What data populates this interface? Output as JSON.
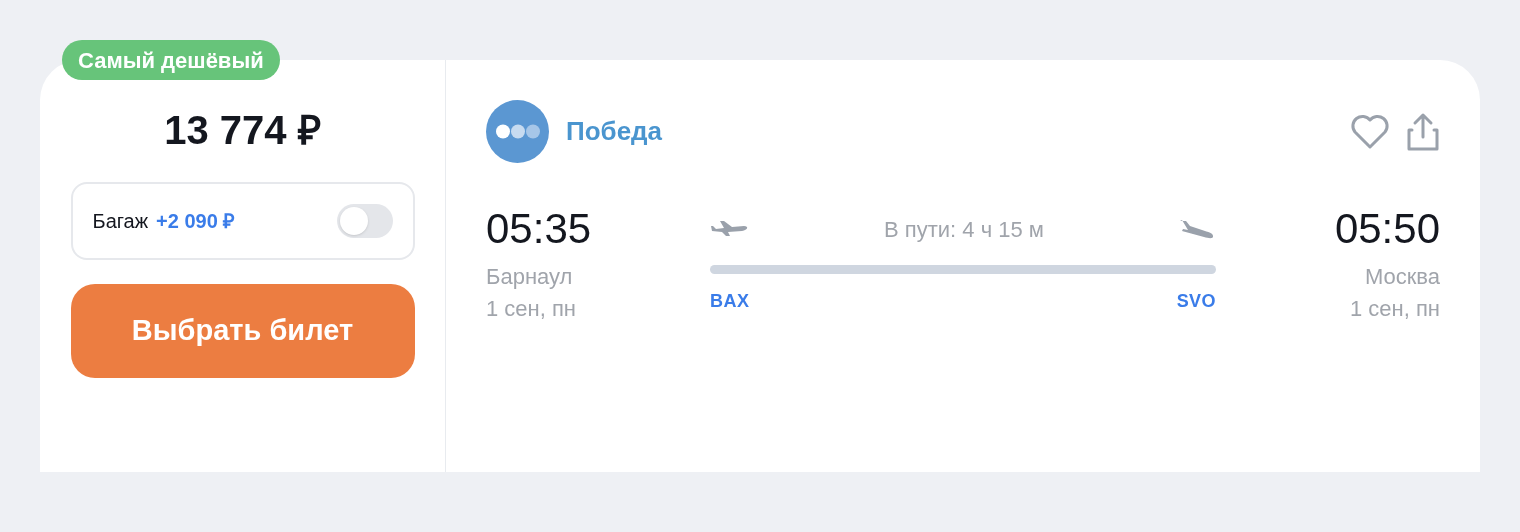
{
  "badge": "Самый дешёвый",
  "price": "13 774 ₽",
  "baggage": {
    "label": "Багаж",
    "price": "+2 090 ₽",
    "on": false
  },
  "select_button": "Выбрать билет",
  "airline": {
    "name": "Победа"
  },
  "departure": {
    "time": "05:35",
    "city": "Барнаул",
    "date": "1 сен, пн",
    "code": "BAX"
  },
  "duration": "В пути: 4 ч 15 м",
  "arrival": {
    "time": "05:50",
    "city": "Москва",
    "date": "1 сен, пн",
    "code": "SVO"
  }
}
